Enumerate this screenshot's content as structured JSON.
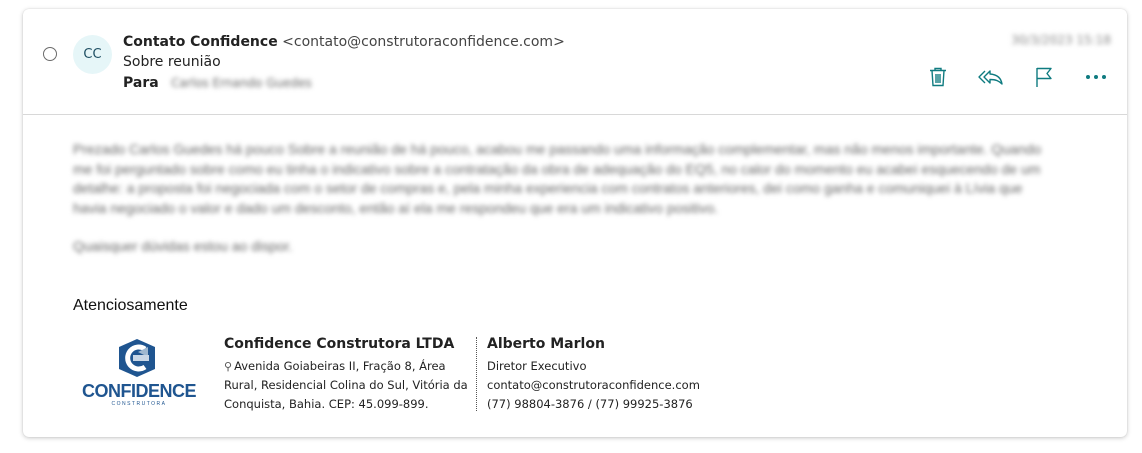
{
  "message": {
    "avatar_initials": "CC",
    "sender_name": "Contato Confidence",
    "sender_email": "<contato@construtoraconfidence.com>",
    "subject": "Sobre reunião",
    "to_label": "Para",
    "to_value": "Carlos Ernando Guedes",
    "date": "30/3/2023 15:18"
  },
  "actions": {
    "delete_icon": "trash-icon",
    "reply_all_icon": "reply-all-icon",
    "flag_icon": "flag-icon",
    "more_icon": "more-horizontal-icon",
    "accent_color": "#0f7b80"
  },
  "body": {
    "paragraph1": "Prezado Carlos Guedes há pouco Sobre a reunião de há pouco, acabou me passando uma informação complementar, mas não menos importante. Quando me foi perguntado sobre como eu tinha o indicativo sobre a contratação da obra de adequação do EQ5, no calor do momento eu acabei esquecendo de um detalhe: a proposta foi negociada com o setor de compras e, pela minha experiencia com contratos anteriores, dei como ganha e comuniquei à Lívia que havia negociado o valor e dado um desconto, então aí ela me respondeu que era um indicativo positivo.",
    "paragraph2": "Quaisquer dúvidas estou ao dispor.",
    "closing": "Atenciosamente"
  },
  "signature": {
    "logo_text": "CONFIDENCE",
    "logo_subtext": "CONSTRUTORA",
    "company_name": "Confidence Construtora LTDA",
    "address": "Avenida Goiabeiras II, Fração 8, Área Rural, Residencial Colina do Sul, Vitória da Conquista, Bahia. CEP: 45.099-899.",
    "person_name": "Alberto Marlon",
    "person_title": "Diretor Executivo",
    "person_email": "contato@construtoraconfidence.com",
    "person_phones": "(77) 98804-3876 / (77) 99925-3876",
    "brand_color": "#1f5590"
  }
}
